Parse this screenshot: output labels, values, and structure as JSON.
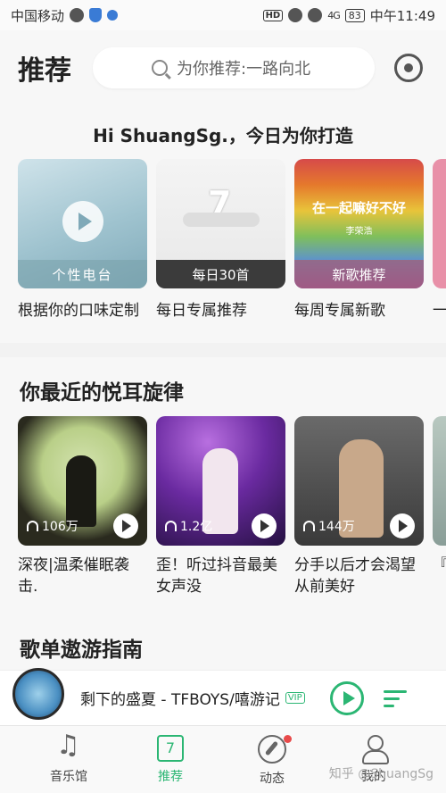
{
  "status_bar": {
    "carrier": "中国移动",
    "network": "4G",
    "battery": "83",
    "time": "中午11:49",
    "hd": "HD"
  },
  "header": {
    "title": "推荐",
    "search_placeholder": "为你推荐:一路向北"
  },
  "recommend": {
    "greeting": "Hi ShuangSg.，今日为你打造",
    "cards": [
      {
        "cover_label": "个性电台",
        "caption": "根据你的口味定制"
      },
      {
        "cover_label": "每日30首",
        "caption": "每日专属推荐",
        "cover_number": "7"
      },
      {
        "cover_label": "新歌推荐",
        "caption": "每周专属新歌",
        "cover_title": "在一起嘛好不好",
        "cover_artist": "李荣浩"
      }
    ],
    "peek_caption": "一"
  },
  "recent": {
    "title": "你最近的悦耳旋律",
    "playlists": [
      {
        "plays": "106万",
        "title": "深夜|温柔催眠袭击."
      },
      {
        "plays": "1.2亿",
        "title": "歪！听过抖音最美女声没"
      },
      {
        "plays": "144万",
        "title": "分手以后才会渴望从前美好"
      }
    ],
    "peek_caption": "『你"
  },
  "guide": {
    "title": "歌单遨游指南"
  },
  "player": {
    "now_playing": "剩下的盛夏 - TFBOYS/嘻游记",
    "vip": "VIP"
  },
  "tabs": [
    {
      "label": "音乐馆",
      "icon": "music-note-icon"
    },
    {
      "label": "推荐",
      "icon": "today-icon",
      "badge": "7"
    },
    {
      "label": "动态",
      "icon": "compass-icon"
    },
    {
      "label": "我的",
      "icon": "user-icon"
    }
  ],
  "watermark": "知乎 @ShuangSg",
  "colors": {
    "accent": "#2bb673",
    "notification": "#e84a4a"
  }
}
